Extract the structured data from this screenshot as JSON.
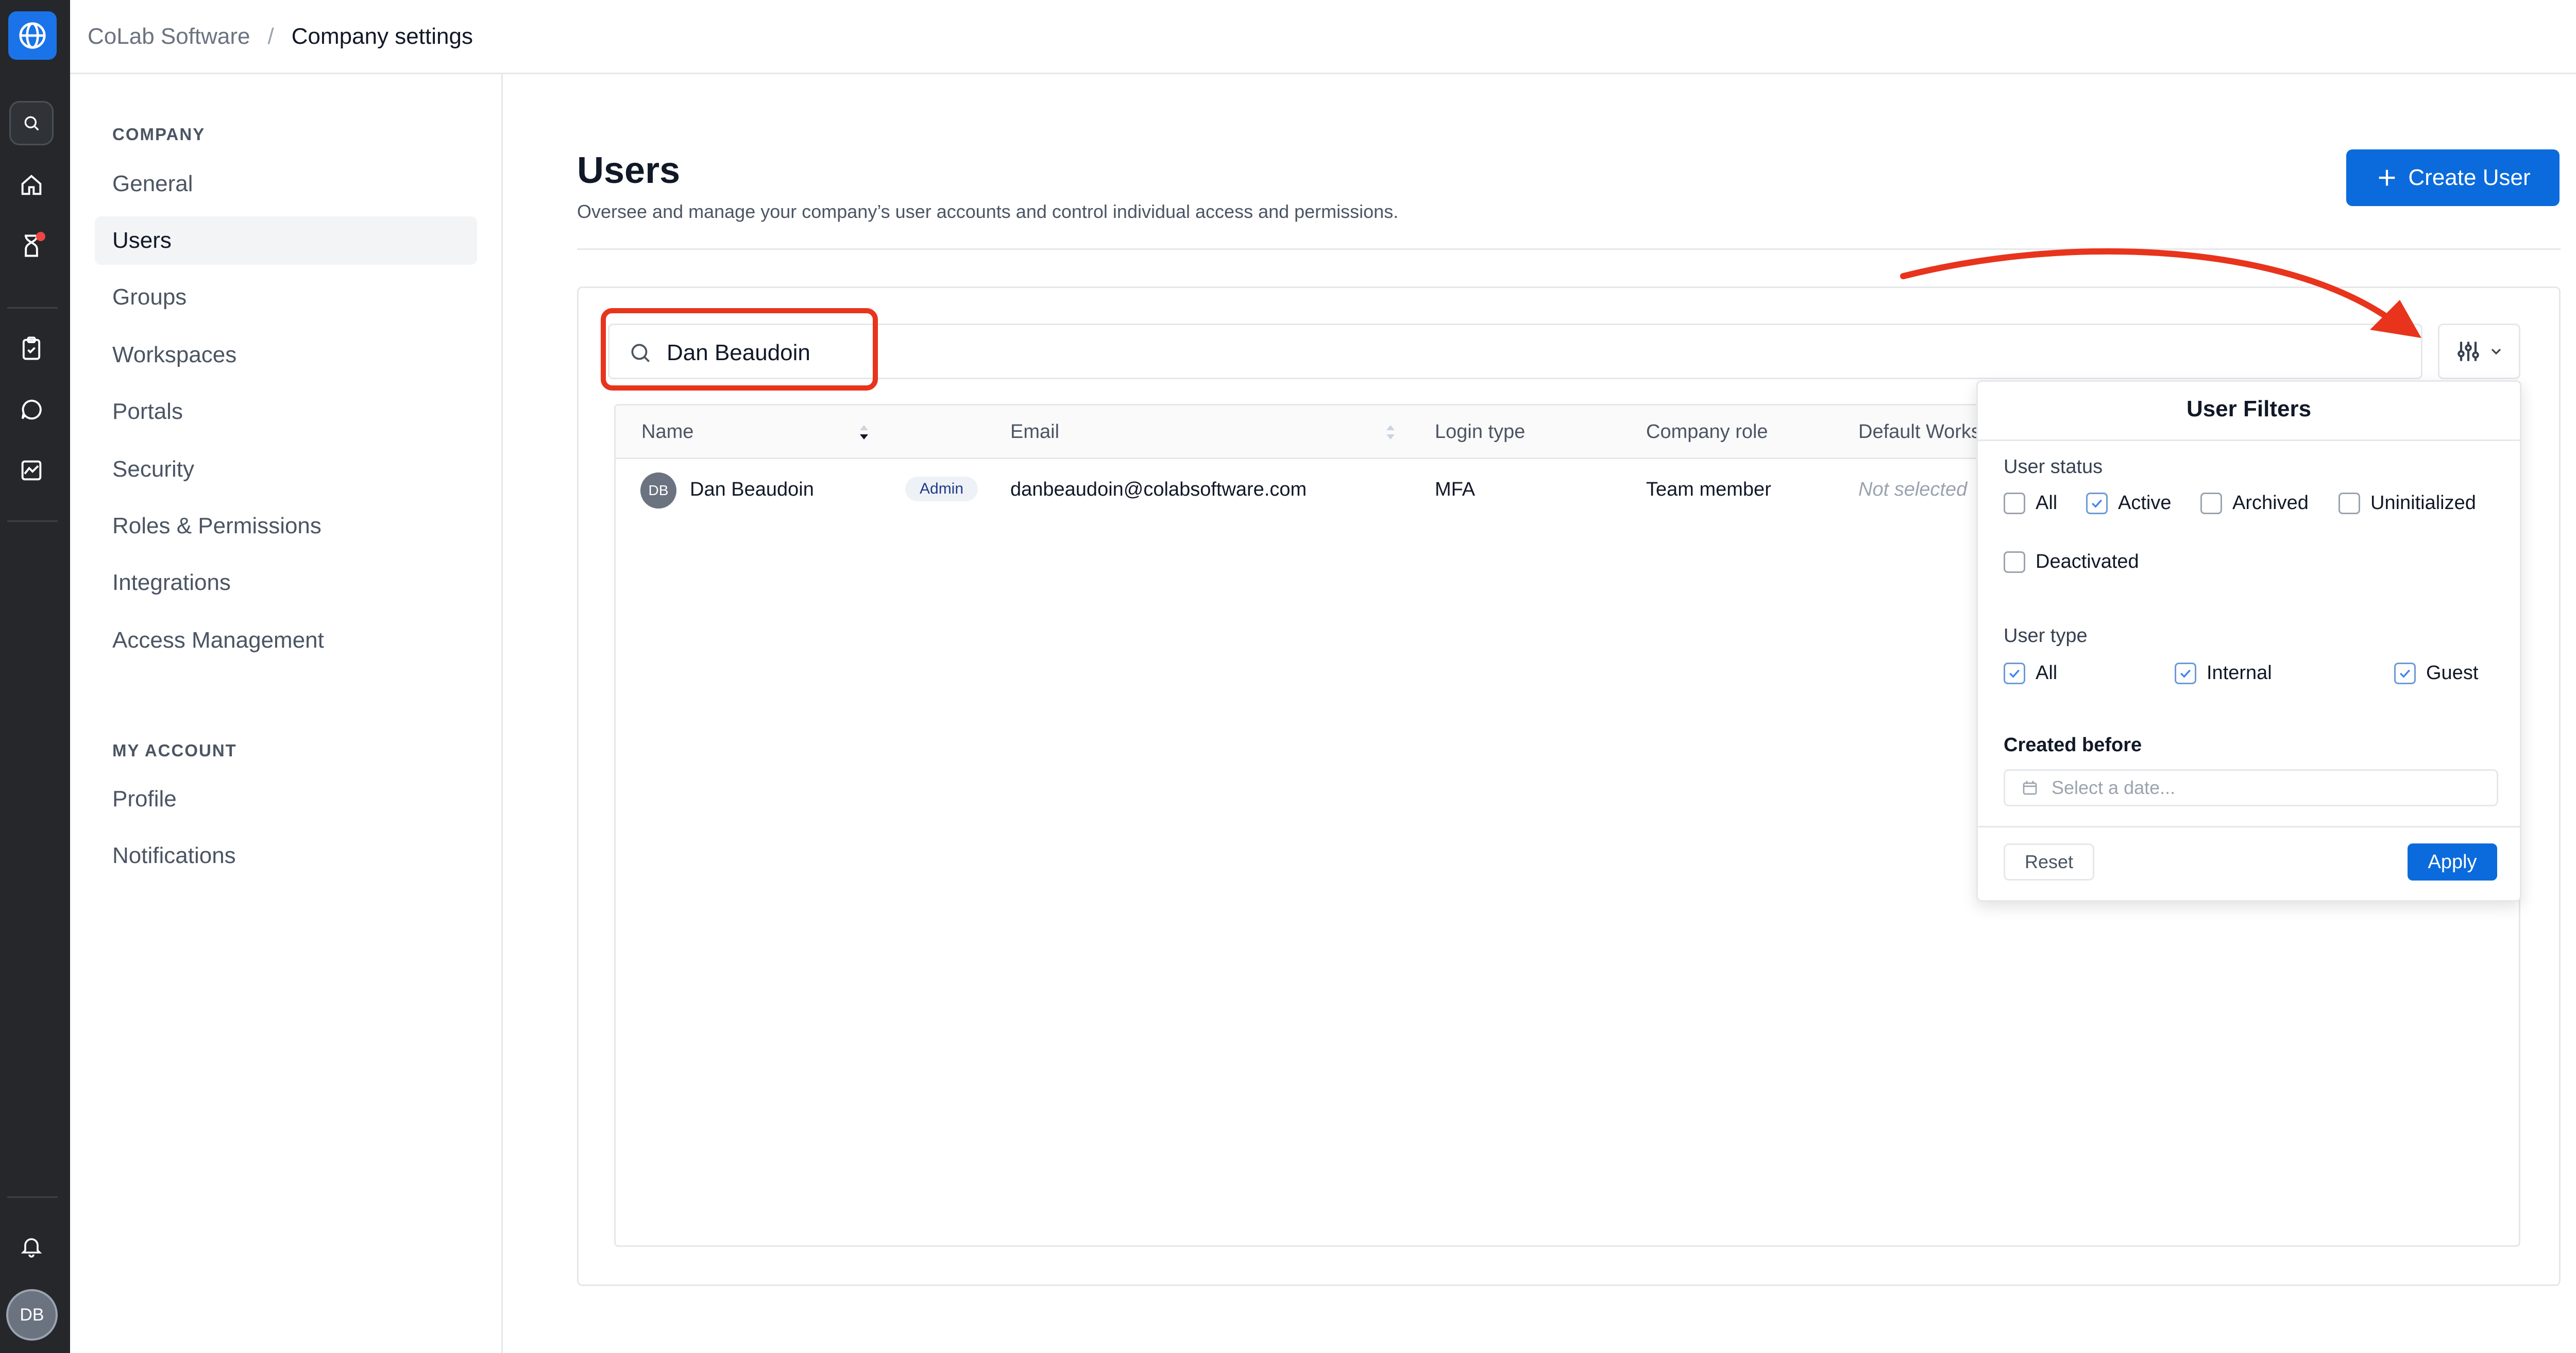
{
  "colors": {
    "accent": "#0b6bdc",
    "annotation": "#e8341c",
    "rail": "#25272b"
  },
  "rail": {
    "icons": [
      "globe-icon",
      "search-icon",
      "home-icon",
      "hourglass-icon",
      "clipboard-check-icon",
      "chat-icon",
      "chart-icon",
      "bell-icon"
    ],
    "avatar_initials": "DB"
  },
  "breadcrumb": {
    "root": "CoLab Software",
    "separator": "/",
    "current": "Company settings"
  },
  "sidebar": {
    "company_heading": "COMPANY",
    "company_items": [
      {
        "label": "General"
      },
      {
        "label": "Users",
        "active": true
      },
      {
        "label": "Groups"
      },
      {
        "label": "Workspaces"
      },
      {
        "label": "Portals"
      },
      {
        "label": "Security"
      },
      {
        "label": "Roles & Permissions"
      },
      {
        "label": "Integrations"
      },
      {
        "label": "Access Management"
      }
    ],
    "account_heading": "MY ACCOUNT",
    "account_items": [
      {
        "label": "Profile"
      },
      {
        "label": "Notifications"
      }
    ]
  },
  "page": {
    "title": "Users",
    "subtitle": "Oversee and manage your company’s user accounts and control individual access and permissions.",
    "create_button": "Create User"
  },
  "search": {
    "value": "Dan Beaudoin"
  },
  "table": {
    "columns": [
      "Name",
      "Email",
      "Login type",
      "Company role",
      "Default Works"
    ],
    "rows": [
      {
        "initials": "DB",
        "name": "Dan Beaudoin",
        "badge": "Admin",
        "email": "danbeaudoin@colabsoftware.com",
        "login_type": "MFA",
        "company_role": "Team member",
        "default_workspace": "Not selected"
      }
    ]
  },
  "filters": {
    "title": "User Filters",
    "status_label": "User status",
    "status_options": [
      {
        "label": "All",
        "checked": false
      },
      {
        "label": "Active",
        "checked": true
      },
      {
        "label": "Archived",
        "checked": false
      },
      {
        "label": "Uninitialized",
        "checked": false
      },
      {
        "label": "Deactivated",
        "checked": false
      }
    ],
    "type_label": "User type",
    "type_options": [
      {
        "label": "All",
        "checked": true
      },
      {
        "label": "Internal",
        "checked": true
      },
      {
        "label": "Guest",
        "checked": true
      }
    ],
    "created_label": "Created before",
    "date_placeholder": "Select a date...",
    "reset": "Reset",
    "apply": "Apply"
  }
}
